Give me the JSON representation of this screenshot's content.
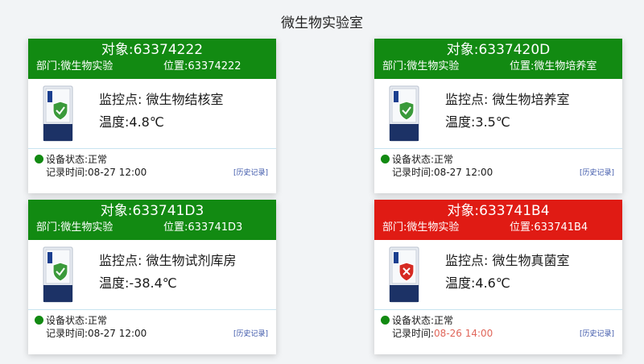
{
  "page": {
    "title": "微生物实验室"
  },
  "colors": {
    "ok": "#128a12",
    "alarm": "#e01b14",
    "alert_time": "#e0665a",
    "link": "#3a54a8"
  },
  "cards": [
    {
      "title": "对象:63374222",
      "dept": "部门:微生物实验",
      "location": "位置:63374222",
      "monitor_point": "监控点:  微生物结核室",
      "temperature": "温度:4.8℃",
      "status": "设备状态:正常",
      "record_label": "记录时间:",
      "record_time": "08-27 12:00",
      "history_link": "[历史记录]",
      "state": "ok",
      "icon": "freezer-ok-icon"
    },
    {
      "title": "对象:6337420D",
      "dept": "部门:微生物实验",
      "location": "位置:微生物培养室",
      "monitor_point": "监控点:  微生物培养室",
      "temperature": "温度:3.5℃",
      "status": "设备状态:正常",
      "record_label": "记录时间:",
      "record_time": "08-27 12:00",
      "history_link": "[历史记录]",
      "state": "ok",
      "icon": "freezer-ok-icon"
    },
    {
      "title": "对象:633741D3",
      "dept": "部门:微生物实验",
      "location": "位置:633741D3",
      "monitor_point": "监控点:  微生物试剂库房",
      "temperature": "温度:-38.4℃",
      "status": "设备状态:正常",
      "record_label": "记录时间:",
      "record_time": "08-27 12:00",
      "history_link": "[历史记录]",
      "state": "ok",
      "icon": "freezer-ok-icon"
    },
    {
      "title": "对象:633741B4",
      "dept": "部门:微生物实验",
      "location": "位置:633741B4",
      "monitor_point": "监控点:  微生物真菌室",
      "temperature": "温度:4.6℃",
      "status": "设备状态:正常",
      "record_label": "记录时间:",
      "record_time": "08-26 14:00",
      "history_link": "[历史记录]",
      "state": "alarm",
      "icon": "freezer-alarm-icon"
    }
  ]
}
